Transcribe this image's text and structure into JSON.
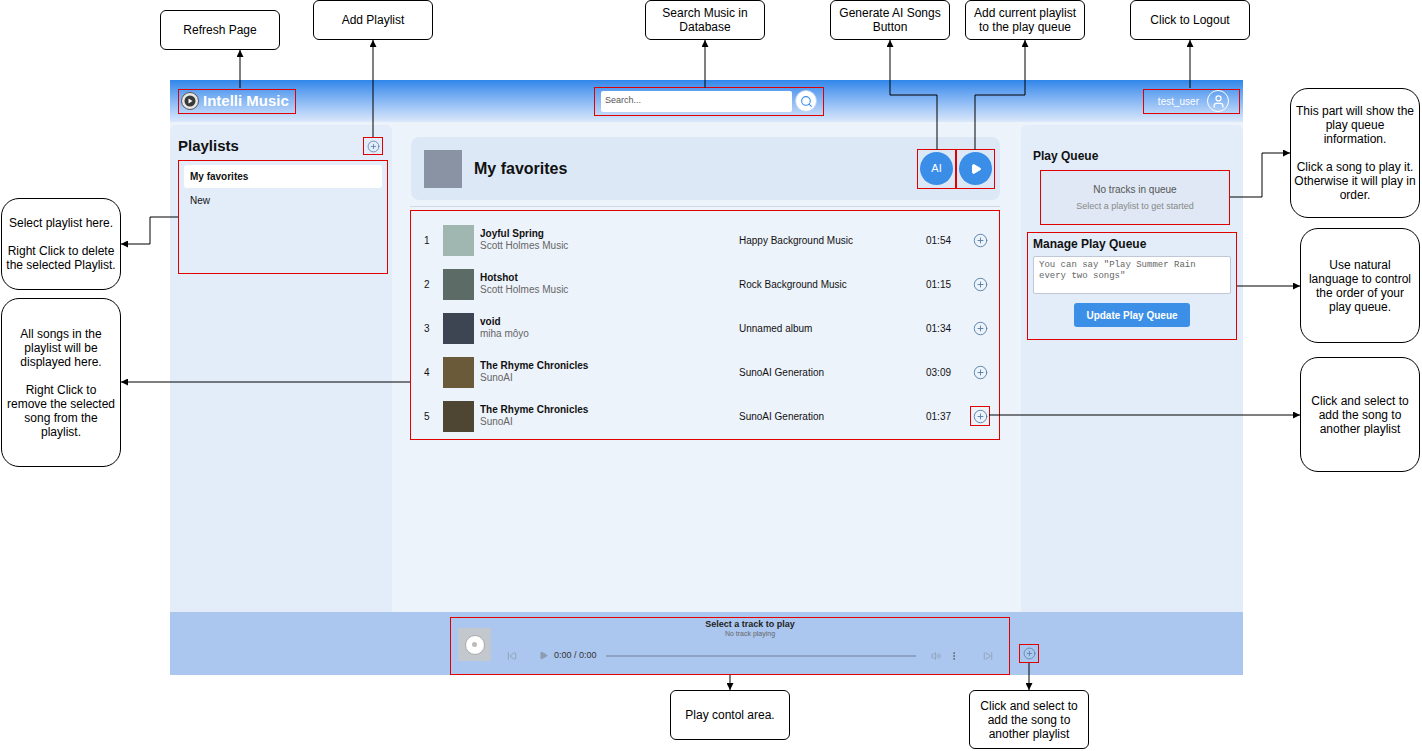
{
  "app": {
    "logo": "Intelli Music",
    "search": {
      "placeholder": "Search..."
    },
    "user": "test_user"
  },
  "sidebar": {
    "title": "Playlists",
    "items": [
      {
        "label": "My favorites",
        "selected": true
      },
      {
        "label": "New",
        "selected": false
      }
    ]
  },
  "playlist": {
    "title": "My favorites",
    "ai_button": "AI",
    "tracks": [
      {
        "number": "1",
        "title": "Joyful Spring",
        "artist": "Scott Holmes Music",
        "album": "Happy Background Music",
        "duration": "01:54"
      },
      {
        "number": "2",
        "title": "Hotshot",
        "artist": "Scott Holmes Music",
        "album": "Rock Background Music",
        "duration": "01:15"
      },
      {
        "number": "3",
        "title": "void",
        "artist": "miha môyo",
        "album": "Unnamed album",
        "duration": "01:34"
      },
      {
        "number": "4",
        "title": "The Rhyme Chronicles",
        "artist": "SunoAI",
        "album": "SunoAI Generation",
        "duration": "03:09"
      },
      {
        "number": "5",
        "title": "The Rhyme Chronicles",
        "artist": "SunoAI",
        "album": "SunoAI Generation",
        "duration": "01:37"
      }
    ]
  },
  "play_queue": {
    "title": "Play Queue",
    "empty_title": "No tracks in queue",
    "empty_hint": "Select a playlist to get started"
  },
  "manage_queue": {
    "title": "Manage Play Queue",
    "placeholder": "You can say \"Play Summer Rain every two songs\"",
    "button": "Update Play Queue"
  },
  "player": {
    "title": "Select a track to play",
    "subtitle": "No track playing",
    "time": "0:00 / 0:00",
    "level": 0
  },
  "annotations": [
    {
      "lines": [
        "Refresh Page"
      ]
    },
    {
      "lines": [
        "Add Playlist"
      ]
    },
    {
      "lines": [
        "Search Music in Database"
      ]
    },
    {
      "lines": [
        "Generate AI Songs Button"
      ]
    },
    {
      "lines": [
        "Add current playlist to the play queue"
      ]
    },
    {
      "lines": [
        "Click to Logout"
      ]
    },
    {
      "lines": [
        "This part will show the play queue information.",
        "Click a song to play it. Otherwise it will play in order."
      ]
    },
    {
      "lines": [
        "Use natural language to control the order of your play queue."
      ]
    },
    {
      "lines": [
        "Click and select to add the song to another playlist"
      ]
    },
    {
      "lines": [
        "Select playlist here.",
        "Right Click to delete the selected Playlist."
      ]
    },
    {
      "lines": [
        "All songs in the playlist will be displayed here.",
        "Right Click to remove the selected song from the playlist."
      ]
    },
    {
      "lines": [
        "Play contol area."
      ]
    },
    {
      "lines": [
        "Click and select to add the song to another playlist"
      ]
    }
  ]
}
